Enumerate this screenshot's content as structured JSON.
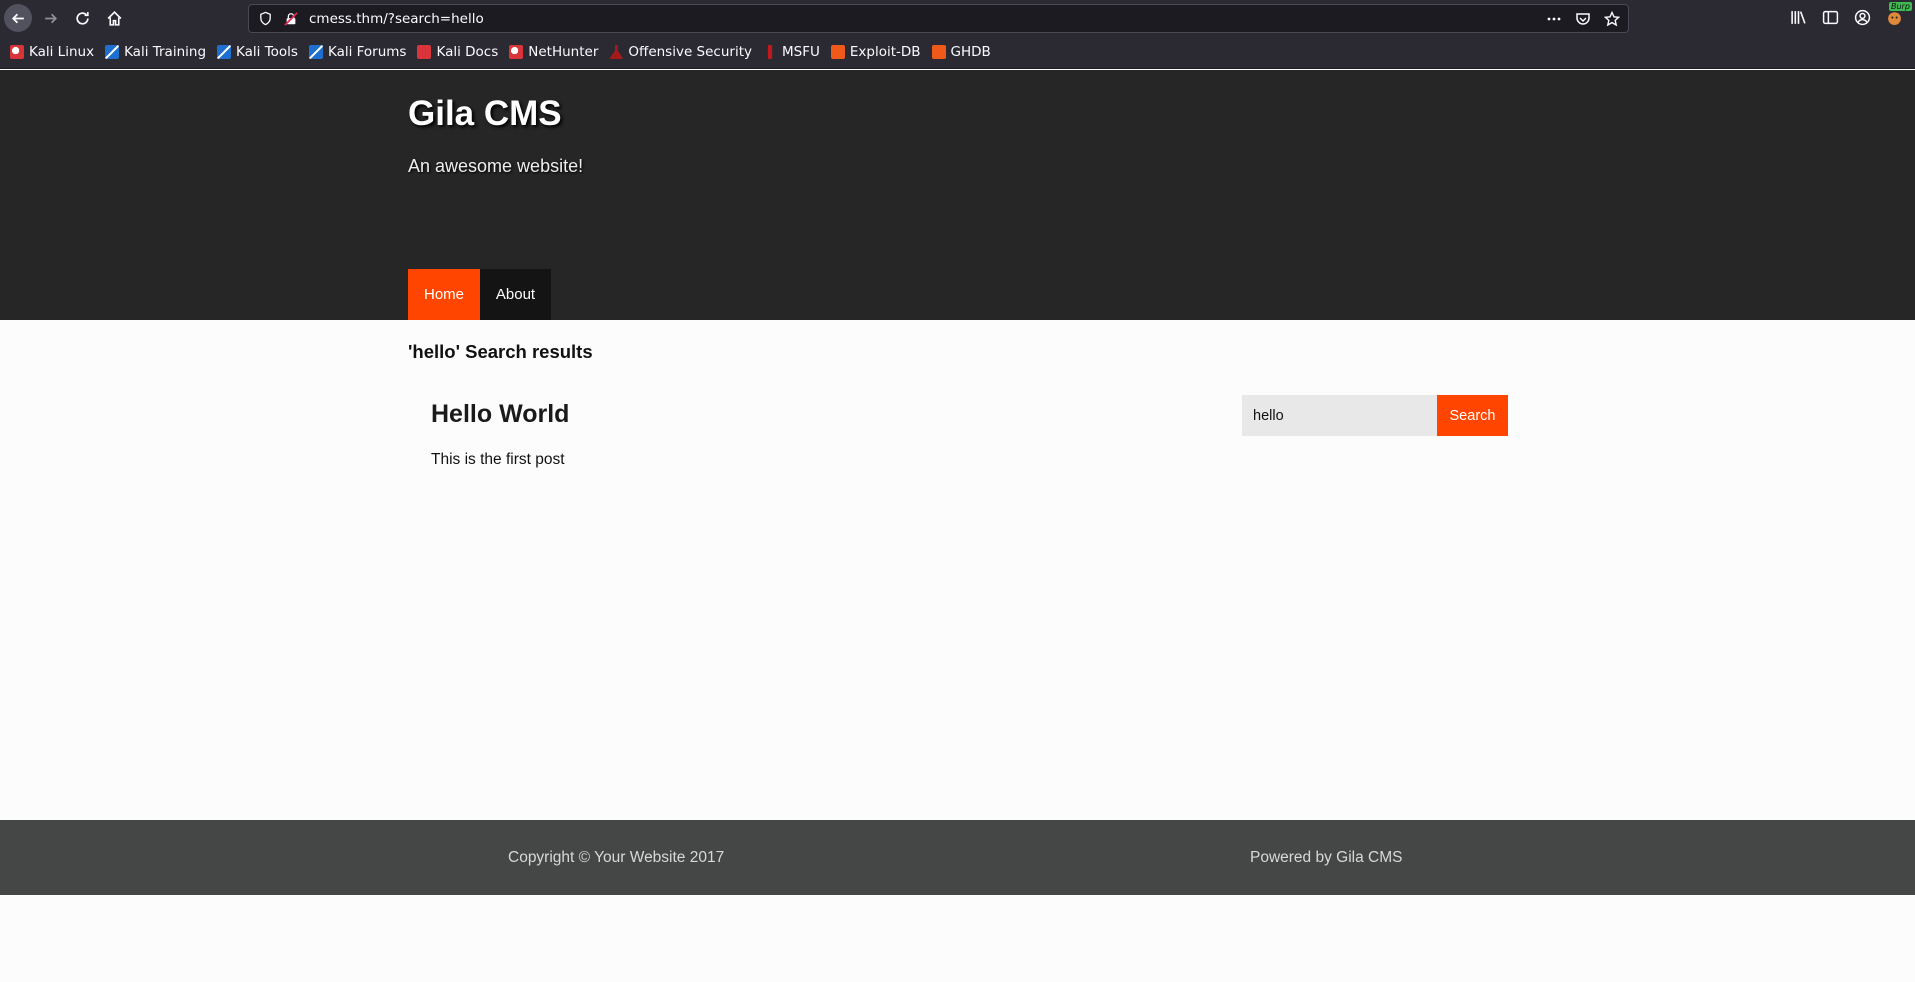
{
  "browser": {
    "url": "cmess.thm/?search=hello",
    "burp_badge": "Burp",
    "bookmarks": [
      {
        "label": "Kali Linux",
        "icon": "kali-dragon-icon"
      },
      {
        "label": "Kali Training",
        "icon": "kali-training-icon"
      },
      {
        "label": "Kali Tools",
        "icon": "kali-tools-icon"
      },
      {
        "label": "Kali Forums",
        "icon": "kali-forums-icon"
      },
      {
        "label": "Kali Docs",
        "icon": "kali-docs-icon"
      },
      {
        "label": "NetHunter",
        "icon": "nethunter-icon"
      },
      {
        "label": "Offensive Security",
        "icon": "offsec-icon"
      },
      {
        "label": "MSFU",
        "icon": "msfu-icon"
      },
      {
        "label": "Exploit-DB",
        "icon": "exploit-db-icon"
      },
      {
        "label": "GHDB",
        "icon": "ghdb-icon"
      }
    ]
  },
  "site": {
    "title": "Gila CMS",
    "tagline": "An awesome website!",
    "nav": [
      {
        "label": "Home",
        "active": true
      },
      {
        "label": "About",
        "active": false
      }
    ]
  },
  "main": {
    "results_heading": "'hello' Search results",
    "post": {
      "title": "Hello World",
      "excerpt": "This is the first post"
    },
    "search": {
      "value": "hello",
      "button_label": "Search"
    }
  },
  "footer": {
    "copyright": "Copyright © Your Website 2017",
    "powered_by": "Powered by Gila CMS"
  },
  "colors": {
    "accent": "#ff4500",
    "header_bg": "#262626",
    "footer_bg": "#454746",
    "browser_chrome": "#2b2a33"
  }
}
